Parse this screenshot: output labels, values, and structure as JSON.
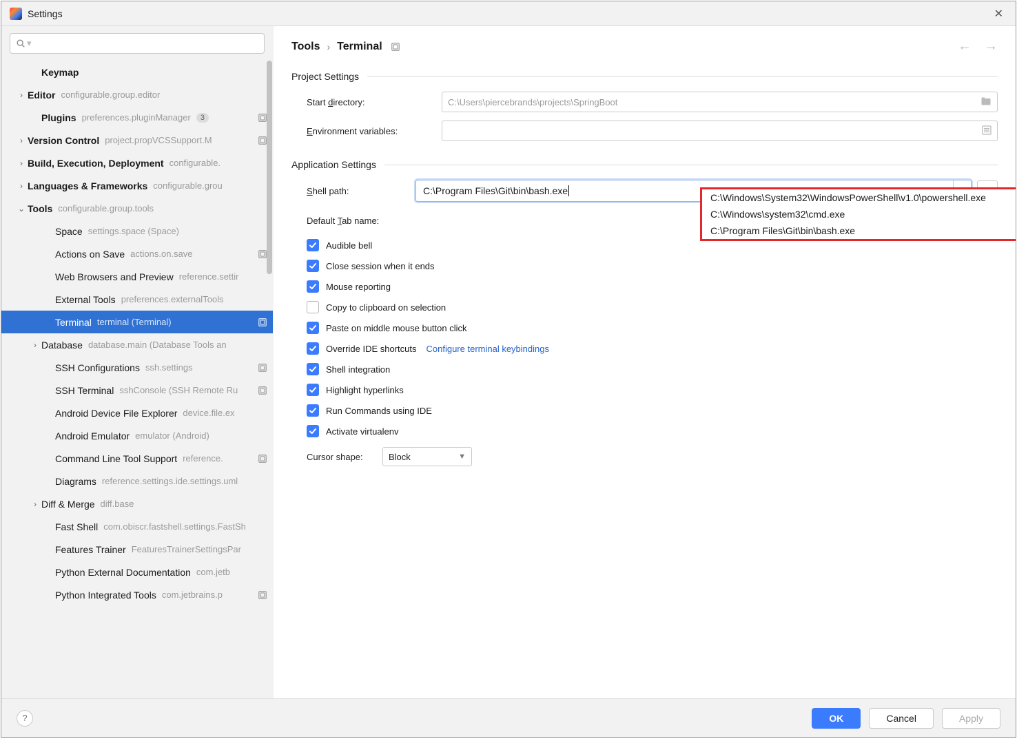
{
  "window": {
    "title": "Settings"
  },
  "sidebar": {
    "items": [
      {
        "label": "Keymap",
        "bold": true,
        "depth": 1
      },
      {
        "label": "Editor",
        "bold": true,
        "sub": "configurable.group.editor",
        "chev": "right",
        "depth": 0
      },
      {
        "label": "Plugins",
        "bold": true,
        "sub": "preferences.pluginManager",
        "depth": 1,
        "badge": "3",
        "proj": true
      },
      {
        "label": "Version Control",
        "bold": true,
        "sub": "project.propVCSSupport.M",
        "chev": "right",
        "depth": 0,
        "proj": true
      },
      {
        "label": "Build, Execution, Deployment",
        "bold": true,
        "sub": "configurable.",
        "chev": "right",
        "depth": 0
      },
      {
        "label": "Languages & Frameworks",
        "bold": true,
        "sub": "configurable.grou",
        "chev": "right",
        "depth": 0
      },
      {
        "label": "Tools",
        "bold": true,
        "sub": "configurable.group.tools",
        "chev": "down",
        "depth": 0
      },
      {
        "label": "Space",
        "sub": "settings.space (Space)",
        "depth": 2
      },
      {
        "label": "Actions on Save",
        "sub": "actions.on.save",
        "depth": 2,
        "proj": true
      },
      {
        "label": "Web Browsers and Preview",
        "sub": "reference.settir",
        "depth": 2
      },
      {
        "label": "External Tools",
        "sub": "preferences.externalTools",
        "depth": 2
      },
      {
        "label": "Terminal",
        "sub": "terminal (Terminal)",
        "depth": 2,
        "selected": true,
        "proj": true
      },
      {
        "label": "Database",
        "sub": "database.main (Database Tools an",
        "chev": "right",
        "depth": 1
      },
      {
        "label": "SSH Configurations",
        "sub": "ssh.settings",
        "depth": 2,
        "proj": true
      },
      {
        "label": "SSH Terminal",
        "sub": "sshConsole (SSH Remote Ru",
        "depth": 2,
        "proj": true
      },
      {
        "label": "Android Device File Explorer",
        "sub": "device.file.ex",
        "depth": 2
      },
      {
        "label": "Android Emulator",
        "sub": "emulator (Android)",
        "depth": 2
      },
      {
        "label": "Command Line Tool Support",
        "sub": "reference.",
        "depth": 2,
        "proj": true
      },
      {
        "label": "Diagrams",
        "sub": "reference.settings.ide.settings.uml",
        "depth": 2
      },
      {
        "label": "Diff & Merge",
        "sub": "diff.base",
        "chev": "right",
        "depth": 1
      },
      {
        "label": "Fast Shell",
        "sub": "com.obiscr.fastshell.settings.FastSh",
        "depth": 2
      },
      {
        "label": "Features Trainer",
        "sub": "FeaturesTrainerSettingsPar",
        "depth": 2
      },
      {
        "label": "Python External Documentation",
        "sub": "com.jetb",
        "depth": 2
      },
      {
        "label": "Python Integrated Tools",
        "sub": "com.jetbrains.p",
        "depth": 2,
        "proj": true
      }
    ]
  },
  "breadcrumb": {
    "root": "Tools",
    "leaf": "Terminal"
  },
  "sections": {
    "project": "Project Settings",
    "app": "Application Settings"
  },
  "labels": {
    "start_dir_pre": "Start ",
    "start_dir_ul": "d",
    "start_dir_post": "irectory:",
    "env_ul": "E",
    "env_post": "nvironment variables:",
    "shell_ul": "S",
    "shell_post": "hell path:",
    "tab_pre": "Default ",
    "tab_ul": "T",
    "tab_post": "ab name:",
    "cursor_shape": "Cursor shape:"
  },
  "fields": {
    "start_dir": "C:\\Users\\piercebrands\\projects\\SpringBoot",
    "env_vars": "",
    "shell_path": "C:\\Program Files\\Git\\bin\\bash.exe",
    "tab_name": "",
    "cursor_shape": "Block"
  },
  "shell_options": [
    "C:\\Windows\\System32\\WindowsPowerShell\\v1.0\\powershell.exe",
    "C:\\Windows\\system32\\cmd.exe",
    "C:\\Program Files\\Git\\bin\\bash.exe"
  ],
  "checks": [
    {
      "id": "audible-bell",
      "label": "Audible bell",
      "checked": true
    },
    {
      "id": "close-session",
      "label": "Close session when it ends",
      "checked": true
    },
    {
      "id": "mouse-reporting",
      "label": "Mouse reporting",
      "checked": true
    },
    {
      "id": "copy-clipboard",
      "label": "Copy to clipboard on selection",
      "checked": false
    },
    {
      "id": "paste-middle",
      "label": "Paste on middle mouse button click",
      "checked": true
    },
    {
      "id": "override-ide",
      "label": "Override IDE shortcuts",
      "checked": true,
      "link": "Configure terminal keybindings"
    },
    {
      "id": "shell-integration",
      "label": "Shell integration",
      "checked": true
    },
    {
      "id": "highlight-links",
      "label": "Highlight hyperlinks",
      "checked": true
    },
    {
      "id": "run-commands-ide",
      "label": "Run Commands using IDE",
      "checked": true
    },
    {
      "id": "activate-venv",
      "label": "Activate virtualenv",
      "checked": true
    }
  ],
  "footer": {
    "ok": "OK",
    "cancel": "Cancel",
    "apply": "Apply"
  }
}
